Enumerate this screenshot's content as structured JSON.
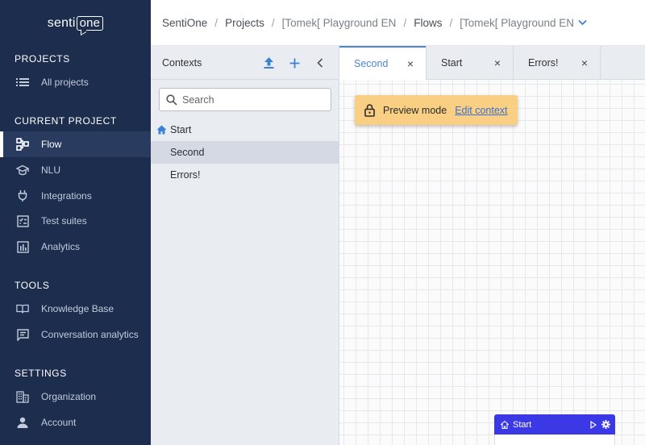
{
  "app": {
    "logo_main": "senti",
    "logo_box": "one"
  },
  "breadcrumb": {
    "items": [
      "SentiOne",
      "Projects",
      "[Tomek[ Playground EN",
      "Flows",
      "[Tomek[ Playground EN"
    ],
    "separator": "/"
  },
  "sidebar": {
    "sections": {
      "projects": "PROJECTS",
      "current_project": "CURRENT PROJECT",
      "tools": "TOOLS",
      "settings": "SETTINGS"
    },
    "items": {
      "all_projects": "All projects",
      "flow": "Flow",
      "nlu": "NLU",
      "integrations": "Integrations",
      "test_suites": "Test suites",
      "analytics": "Analytics",
      "knowledge_base": "Knowledge Base",
      "conversation_analytics": "Conversation analytics",
      "organization": "Organization",
      "account": "Account"
    },
    "active_item": "Flow"
  },
  "contexts": {
    "title": "Contexts",
    "search_placeholder": "Search",
    "items": [
      "Start",
      "Second",
      "Errors!"
    ],
    "selected": "Second"
  },
  "tabs": {
    "items": [
      "Second",
      "Start",
      "Errors!"
    ],
    "active": "Second",
    "close_glyph": "×"
  },
  "canvas": {
    "banner_text": "Preview mode",
    "banner_link": "Edit context",
    "node_label": "Start"
  },
  "colors": {
    "sidebar_bg": "#1d2d4e",
    "accent": "#4b86d6",
    "banner_bg": "#f9cf83",
    "node_bg": "#3b38e6"
  }
}
